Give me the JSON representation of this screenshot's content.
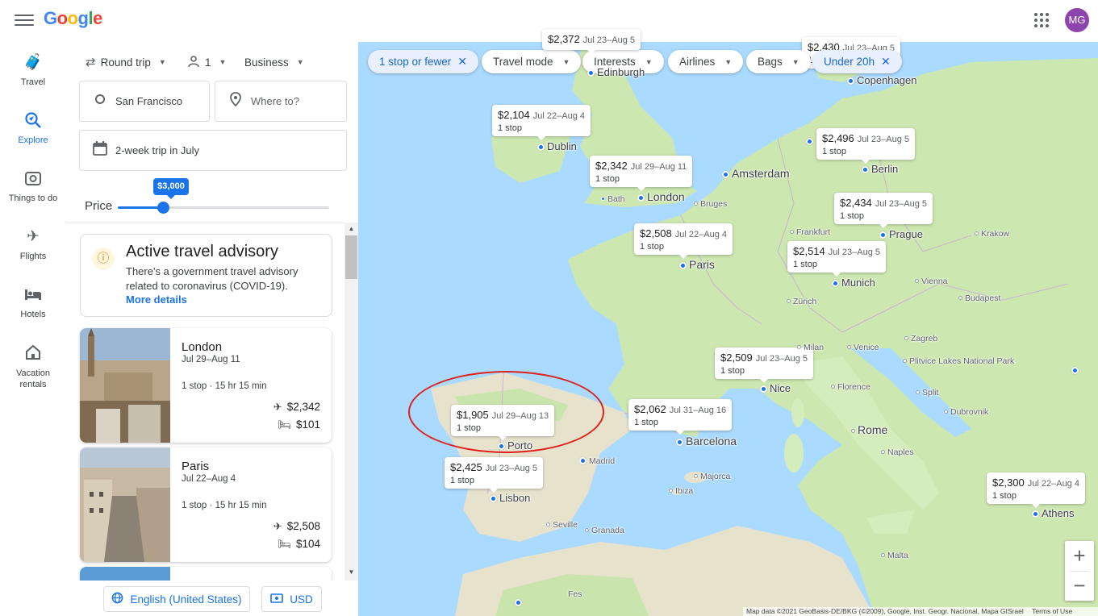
{
  "app": {
    "logo": "Google",
    "avatar_initials": "MG"
  },
  "rail": [
    {
      "label": "Travel",
      "icon": "suitcase-icon"
    },
    {
      "label": "Explore",
      "icon": "explore-icon",
      "active": true
    },
    {
      "label": "Things to do",
      "icon": "camera-icon"
    },
    {
      "label": "Flights",
      "icon": "plane-icon"
    },
    {
      "label": "Hotels",
      "icon": "bed-icon"
    },
    {
      "label": "Vacation rentals",
      "icon": "house-icon"
    }
  ],
  "search": {
    "trip_type": "Round trip",
    "passengers": "1",
    "cabin": "Business",
    "origin": "San Francisco",
    "destination_placeholder": "Where to?",
    "dates": "2-week trip in July"
  },
  "price": {
    "label": "Price",
    "max_value": "$3,000",
    "level_fraction": 0.21
  },
  "advisory": {
    "title": "Active travel advisory",
    "text": "There's a government travel advisory related to coronavirus (COVID-19).",
    "link": "More details"
  },
  "destinations": [
    {
      "name": "London",
      "dates": "Jul 29–Aug 11",
      "stops": "1 stop",
      "duration": "15 hr 15 min",
      "flight_price": "$2,342",
      "hotel_price": "$101"
    },
    {
      "name": "Paris",
      "dates": "Jul 22–Aug 4",
      "stops": "1 stop",
      "duration": "15 hr 15 min",
      "flight_price": "$2,508",
      "hotel_price": "$104"
    }
  ],
  "footer": {
    "language": "English (United States)",
    "currency": "USD"
  },
  "filters": [
    {
      "label": "1 stop or fewer",
      "active": true,
      "closable": true
    },
    {
      "label": "Travel mode",
      "active": false
    },
    {
      "label": "Interests",
      "active": false
    },
    {
      "label": "Airlines",
      "active": false
    },
    {
      "label": "Bags",
      "active": false
    },
    {
      "label": "Under 20h",
      "active": true,
      "closable": true
    }
  ],
  "map_pins": [
    {
      "city": "Dublin",
      "price": "$2,104",
      "dates": "Jul 22–Aug 4",
      "stops": "1 stop"
    },
    {
      "city": "London",
      "price": "$2,342",
      "dates": "Jul 29–Aug 11",
      "stops": "1 stop"
    },
    {
      "city": "Paris",
      "price": "$2,508",
      "dates": "Jul 22–Aug 4",
      "stops": "1 stop"
    },
    {
      "city": "Berlin",
      "price": "$2,496",
      "dates": "Jul 23–Aug 5",
      "stops": "1 stop"
    },
    {
      "city": "Prague",
      "price": "$2,434",
      "dates": "Jul 23–Aug 5",
      "stops": "1 stop"
    },
    {
      "city": "Munich",
      "price": "$2,514",
      "dates": "Jul 23–Aug 5",
      "stops": "1 stop"
    },
    {
      "city": "Nice",
      "price": "$2,509",
      "dates": "Jul 23–Aug 5",
      "stops": "1 stop"
    },
    {
      "city": "Barcelona",
      "price": "$2,062",
      "dates": "Jul 31–Aug 16",
      "stops": "1 stop"
    },
    {
      "city": "Porto",
      "price": "$1,905",
      "dates": "Jul 29–Aug 13",
      "stops": "1 stop"
    },
    {
      "city": "Lisbon",
      "price": "$2,425",
      "dates": "Jul 23–Aug 5",
      "stops": "1 stop"
    },
    {
      "city": "Athens",
      "price": "$2,300",
      "dates": "Jul 22–Aug 4",
      "stops": "1 stop"
    },
    {
      "city": "Copenhagen",
      "price": "$2,430",
      "dates": "Jul 23–Aug 5",
      "stops": "1"
    },
    {
      "city": "Edinburgh",
      "price": "$2,372",
      "dates": "Jul 23–Aug 5",
      "stops": ""
    }
  ],
  "map_labels": {
    "copenhagen": "Copenhagen",
    "edinburgh": "Edinburgh",
    "amsterdam": "Amsterdam",
    "bath": "Bath",
    "bruges": "Bruges",
    "frankfurt": "Frankfurt",
    "krakow": "Krakow",
    "vienna": "Vienna",
    "budapest": "Budapest",
    "zurich": "Zürich",
    "milan": "Milan",
    "venice": "Venice",
    "zagreb": "Zagreb",
    "plitvice": "Plitvice Lakes National Park",
    "florence": "Florence",
    "split": "Split",
    "dubrovnik": "Dubrovnik",
    "rome": "Rome",
    "naples": "Naples",
    "madrid": "Madrid",
    "majorca": "Majorca",
    "ibiza": "Ibiza",
    "seville": "Seville",
    "granada": "Granada",
    "malta": "Malta",
    "fes": "Fes"
  },
  "attribution": "Map data ©2021 GeoBasis-DE/BKG (©2009), Google, Inst. Geogr. Nacional, Mapa GISrael",
  "terms": "Terms of Use",
  "colors": {
    "accent": "#1a73e8",
    "land": "#cde7b0",
    "water": "#aadaff",
    "annotation": "#e0201c"
  }
}
